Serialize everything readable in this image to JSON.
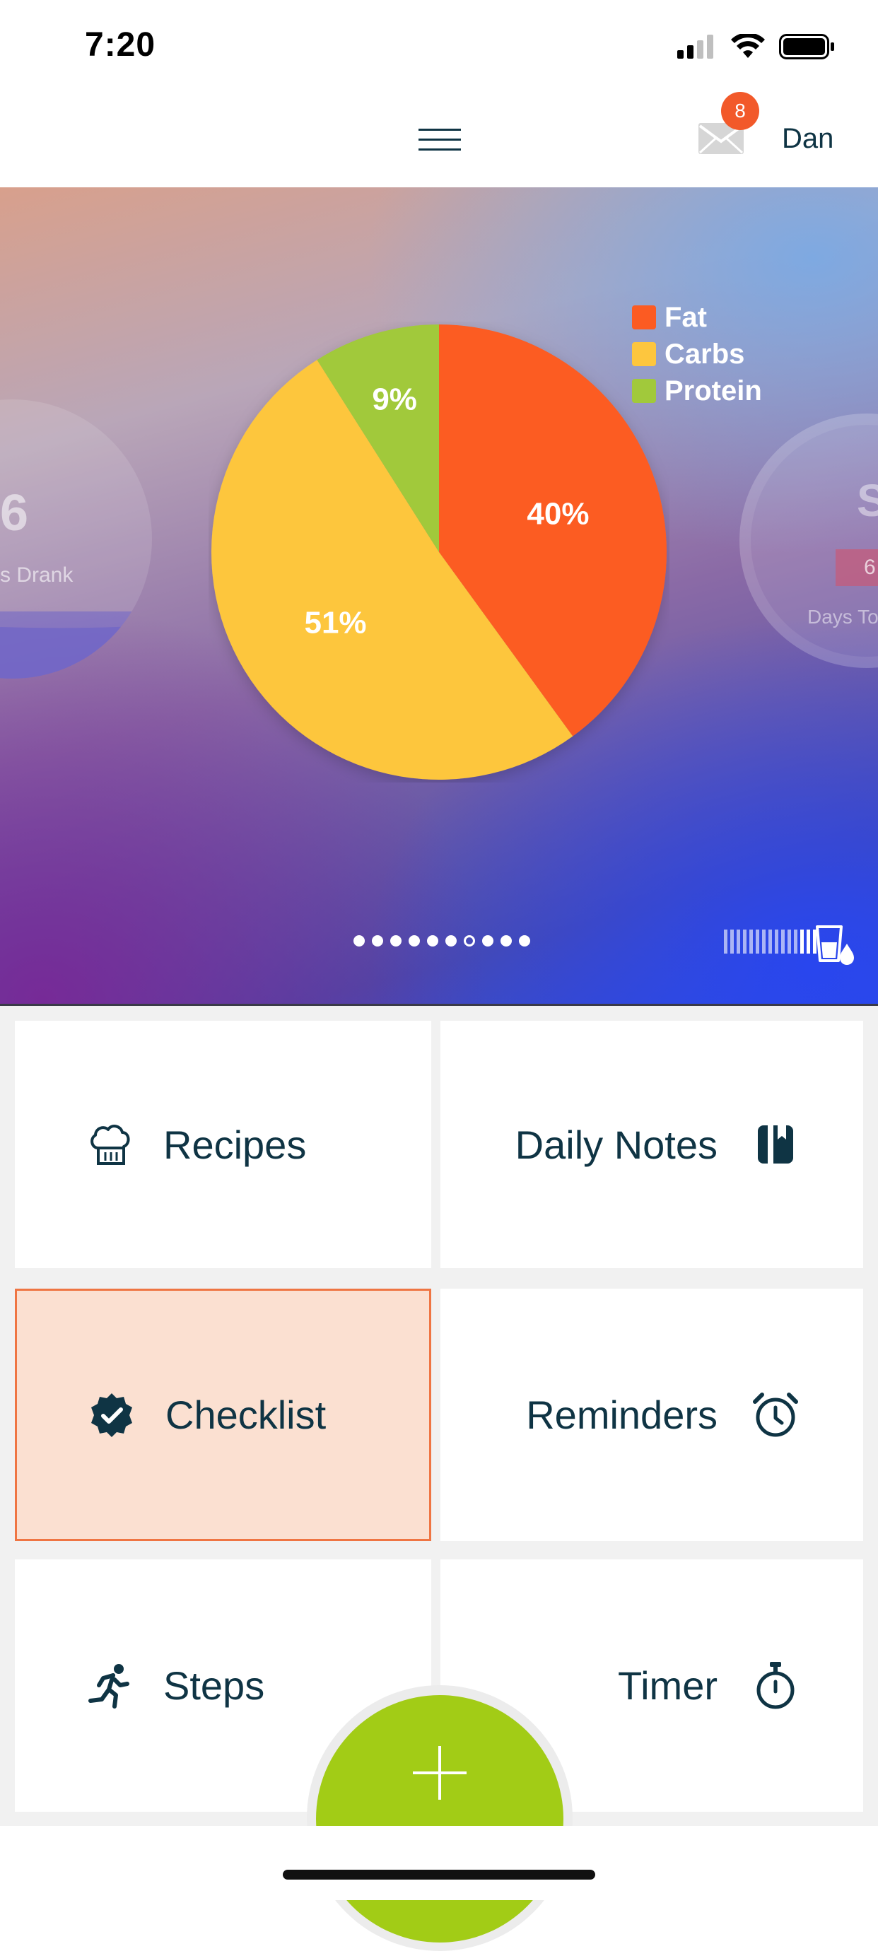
{
  "status_bar": {
    "time": "7:20"
  },
  "header": {
    "mail_badge_count": "8",
    "username": "Dan"
  },
  "hero": {
    "left_card": {
      "value": "6",
      "label": "s Drank"
    },
    "right_card": {
      "value": "S",
      "tag": "6",
      "label": "Days To"
    },
    "pages": {
      "count": 10,
      "active_index": 6
    },
    "water_tracker": {
      "filled_of_total": [
        3,
        15
      ]
    }
  },
  "chart_data": {
    "type": "pie",
    "slices": [
      {
        "label": "Fat",
        "value": 40,
        "display": "40%",
        "color": "#fc5b22"
      },
      {
        "label": "Carbs",
        "value": 51,
        "display": "51%",
        "color": "#fdc63e"
      },
      {
        "label": "Protein",
        "value": 9,
        "display": "9%",
        "color": "#a1c93b"
      }
    ],
    "legend": [
      "Fat",
      "Carbs",
      "Protein"
    ],
    "legend_position": "top-right"
  },
  "tiles": {
    "recipes": "Recipes",
    "daily_notes": "Daily Notes",
    "checklist": "Checklist",
    "reminders": "Reminders",
    "steps": "Steps",
    "timer": "Timer"
  },
  "colors": {
    "accent_text": "#0f3444",
    "selected_tile_bg": "#fbe0d1",
    "selected_tile_border": "#ef7543",
    "fab": "#a2cc16",
    "badge": "#f2592a"
  }
}
